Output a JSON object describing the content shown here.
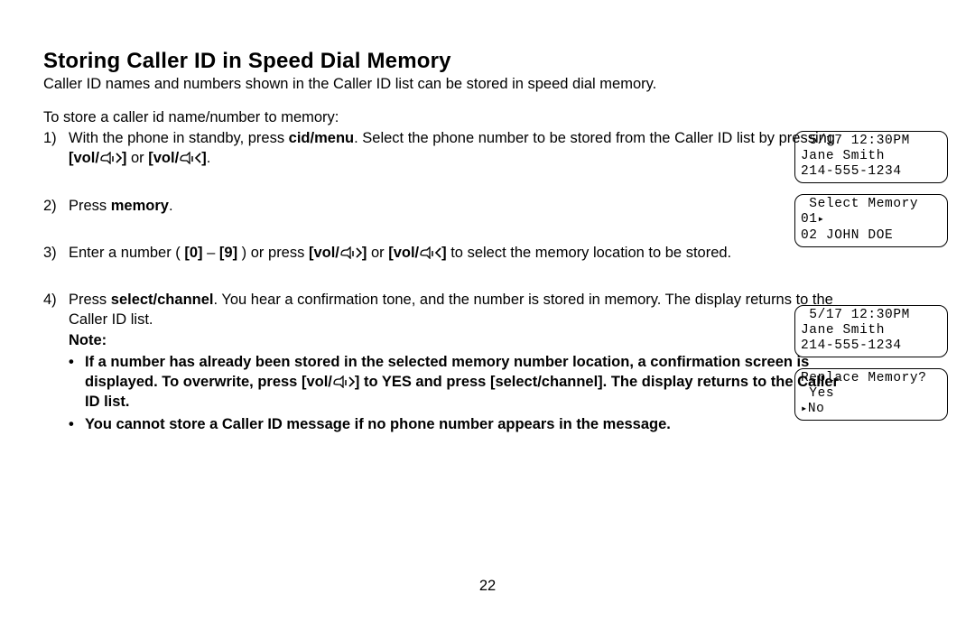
{
  "heading": "Storing Caller ID in Speed Dial Memory",
  "intro": "Caller ID names and numbers shown in the Caller ID list can be stored in speed dial memory.",
  "subIntro": "To store a caller id name/number to memory:",
  "page_number": "22",
  "steps": {
    "s1": {
      "num": "1)",
      "t_a": "With the phone in standby, press ",
      "k_cidmenu": "cid/menu",
      "t_b": ". Select the phone number to be stored from the Caller ID list by pressing ",
      "k_volup_open": "[vol/",
      "k_volup_close": "]",
      "t_or": " or ",
      "k_voldown_open": "[vol/",
      "k_voldown_close": "]",
      "t_c": "."
    },
    "s2": {
      "num": "2)",
      "t_a": "Press ",
      "k_memory": "memory",
      "t_b": "."
    },
    "s3": {
      "num": "3)",
      "t_a": "Enter a number ( ",
      "k_zero": "[0]",
      "t_dash": " – ",
      "k_nine": "[9]",
      "t_b": " ) or press ",
      "k_volup_open": "[vol/",
      "k_volup_close": "]",
      "t_or": " or ",
      "k_voldown_open": "[vol/",
      "k_voldown_close": "]",
      "t_c": " to select the memory location to be stored."
    },
    "s4": {
      "num": "4)",
      "t_a": "Press ",
      "k_select": "select/channel",
      "t_b": ". You hear a confirmation tone, and the number is stored in memory. The display returns to the Caller ID list.",
      "note_label": "Note:",
      "note1_a": "If a number has already been stored in the selected memory number location, a confirmation screen is displayed. To overwrite, press [vol/",
      "note1_b": "] to YES and press [select/channel]. The display returns to the Caller ID list.",
      "note2": "You cannot store a Caller ID message if no phone number appears in the message."
    }
  },
  "screens": {
    "a1": {
      "line1": " 5/17 12:30PM",
      "line2": "Jane Smith",
      "line3": "214-555-1234"
    },
    "a2": {
      "line1": " Select Memory",
      "line2_a": "01",
      "line2_b": "",
      "line3": "02 JOHN DOE"
    },
    "b1": {
      "line1": " 5/17 12:30PM",
      "line2": "Jane Smith",
      "line3": "214-555-1234"
    },
    "b2": {
      "line1": "Replace Memory?",
      "line2": " Yes",
      "line3_a": "",
      "line3_b": "No"
    }
  }
}
